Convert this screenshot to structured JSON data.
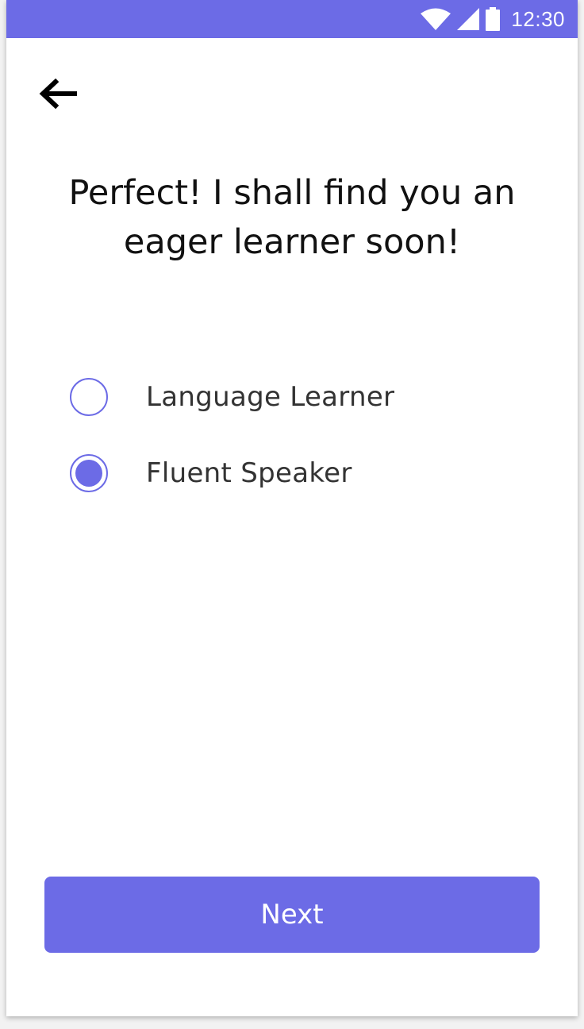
{
  "status_bar": {
    "time": "12:30",
    "icons": [
      "wifi-icon",
      "signal-icon",
      "battery-icon"
    ],
    "background": "#6c6be6"
  },
  "header": {
    "back_icon": "arrow-left-icon",
    "title": "Perfect! I shall find you an\neager learner soon!"
  },
  "options": [
    {
      "label": "Language Learner",
      "selected": false
    },
    {
      "label": "Fluent Speaker",
      "selected": true
    }
  ],
  "actions": {
    "next_label": "Next"
  },
  "colors": {
    "accent": "#6c6be6",
    "title_text": "#111111",
    "option_text": "#333333"
  }
}
